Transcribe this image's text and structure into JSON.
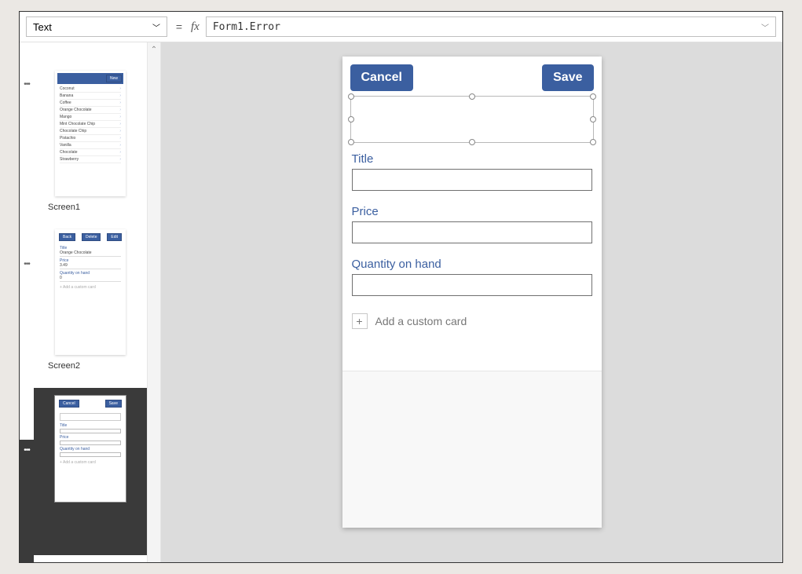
{
  "formulaBar": {
    "property": "Text",
    "equals": "=",
    "fx": "fx",
    "formula": "Form1.Error"
  },
  "thumbnails": {
    "screen1": {
      "label": "Screen1",
      "newBtn": "New",
      "items": [
        "Coconut",
        "Banana",
        "Coffee",
        "Orange Chocolate",
        "Mango",
        "Mint Chocolate Chip",
        "Chocolate Chip",
        "Pistachio",
        "Vanilla",
        "Chocolate",
        "Strawberry"
      ]
    },
    "screen2": {
      "label": "Screen2",
      "backBtn": "Back",
      "deleteBtn": "Delete",
      "editBtn": "Edit",
      "rows": {
        "titleLbl": "Title",
        "titleVal": "Orange Chocolate",
        "priceLbl": "Price",
        "priceVal": "3.49",
        "qtyLbl": "Quantity on hand",
        "qtyVal": "0",
        "addCard": "+  Add a custom card"
      }
    },
    "screen3": {
      "cancelBtn": "Cancel",
      "saveBtn": "Save",
      "titleLbl": "Title",
      "priceLbl": "Price",
      "qtyLbl": "Quantity on hand",
      "addCard": "+  Add a custom card"
    }
  },
  "canvas": {
    "cancel": "Cancel",
    "save": "Save",
    "fields": {
      "title": "Title",
      "price": "Price",
      "qty": "Quantity on hand"
    },
    "addCard": "Add a custom card",
    "plus": "+"
  }
}
